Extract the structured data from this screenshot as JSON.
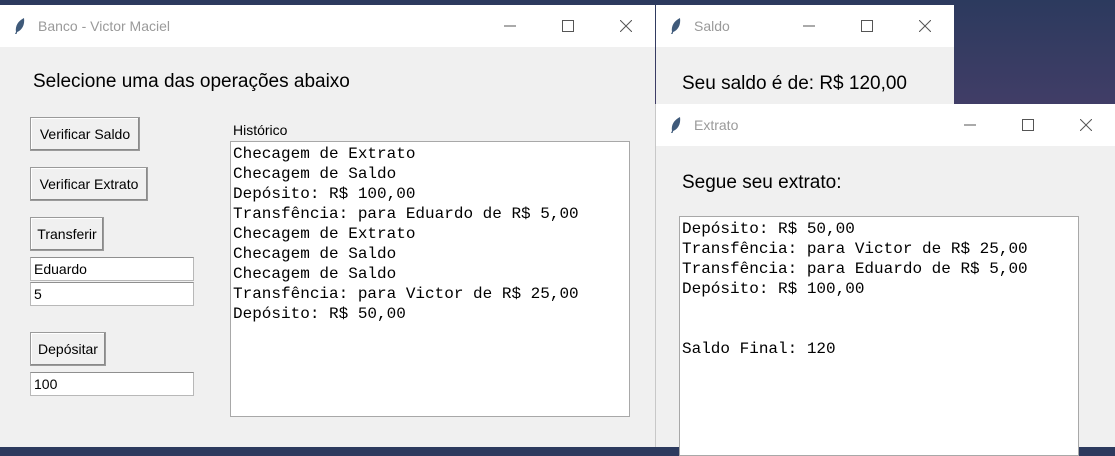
{
  "main_window": {
    "title": "Banco - Victor Maciel",
    "heading": "Selecione uma das operações abaixo",
    "buttons": {
      "verificar_saldo": "Verificar Saldo",
      "verificar_extrato": "Verificar Extrato",
      "transferir": "Transferir",
      "depositar": "Depósitar"
    },
    "transfer_recipient_value": "Eduardo",
    "transfer_amount_value": "5",
    "deposit_amount_value": "100",
    "historico_label": "Histórico",
    "historico_lines": [
      "Checagem de Extrato",
      "Checagem de Saldo",
      "Depósito: R$ 100,00",
      "Transfência: para Eduardo de R$ 5,00",
      "Checagem de Extrato",
      "Checagem de Saldo",
      "Checagem de Saldo",
      "Transfência: para Victor de R$ 25,00",
      "Depósito: R$ 50,00"
    ]
  },
  "saldo_window": {
    "title": "Saldo",
    "message": "Seu saldo é de: R$ 120,00"
  },
  "extrato_window": {
    "title": "Extrato",
    "heading": "Segue seu extrato:",
    "lines": [
      "Depósito: R$ 50,00",
      "Transfência: para Victor de R$ 25,00",
      "Transfência: para Eduardo de R$ 5,00",
      "Depósito: R$ 100,00",
      "",
      "",
      "Saldo Final: 120"
    ]
  },
  "icons": {
    "app": "feather-icon",
    "minimize": "minimize-icon",
    "maximize": "maximize-icon",
    "close": "close-icon"
  }
}
